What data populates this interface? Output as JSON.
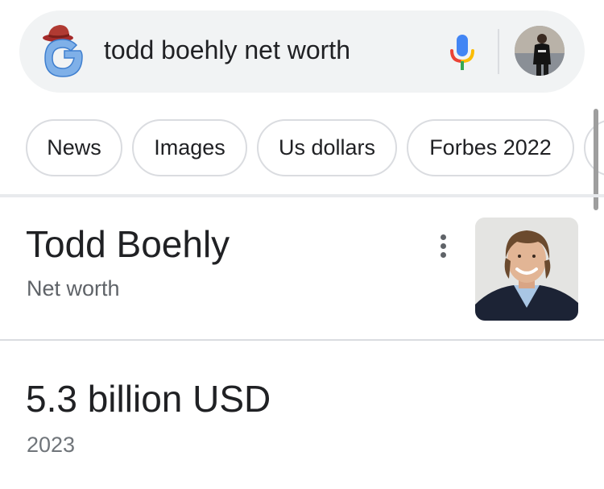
{
  "search": {
    "query": "todd boehly net worth",
    "logo_icon": "google-g-with-hat-icon",
    "mic_icon": "microphone-icon",
    "avatar_icon": "user-avatar"
  },
  "chips": [
    {
      "label": "News"
    },
    {
      "label": "Images"
    },
    {
      "label": "Us dollars"
    },
    {
      "label": "Forbes 2022"
    }
  ],
  "knowledge_panel": {
    "title": "Todd Boehly",
    "subtitle": "Net worth",
    "more_icon": "more-vert-icon",
    "photo_icon": "person-photo"
  },
  "answer": {
    "value": "5.3 billion USD",
    "year": "2023"
  },
  "colors": {
    "search_bar_bg": "#f1f3f4",
    "chip_border": "#dadce0",
    "primary_text": "#202124",
    "secondary_text": "#5f6368",
    "google_blue": "#4285f4",
    "google_red": "#ea4335",
    "google_yellow": "#fbbc04",
    "google_green": "#34a853"
  }
}
